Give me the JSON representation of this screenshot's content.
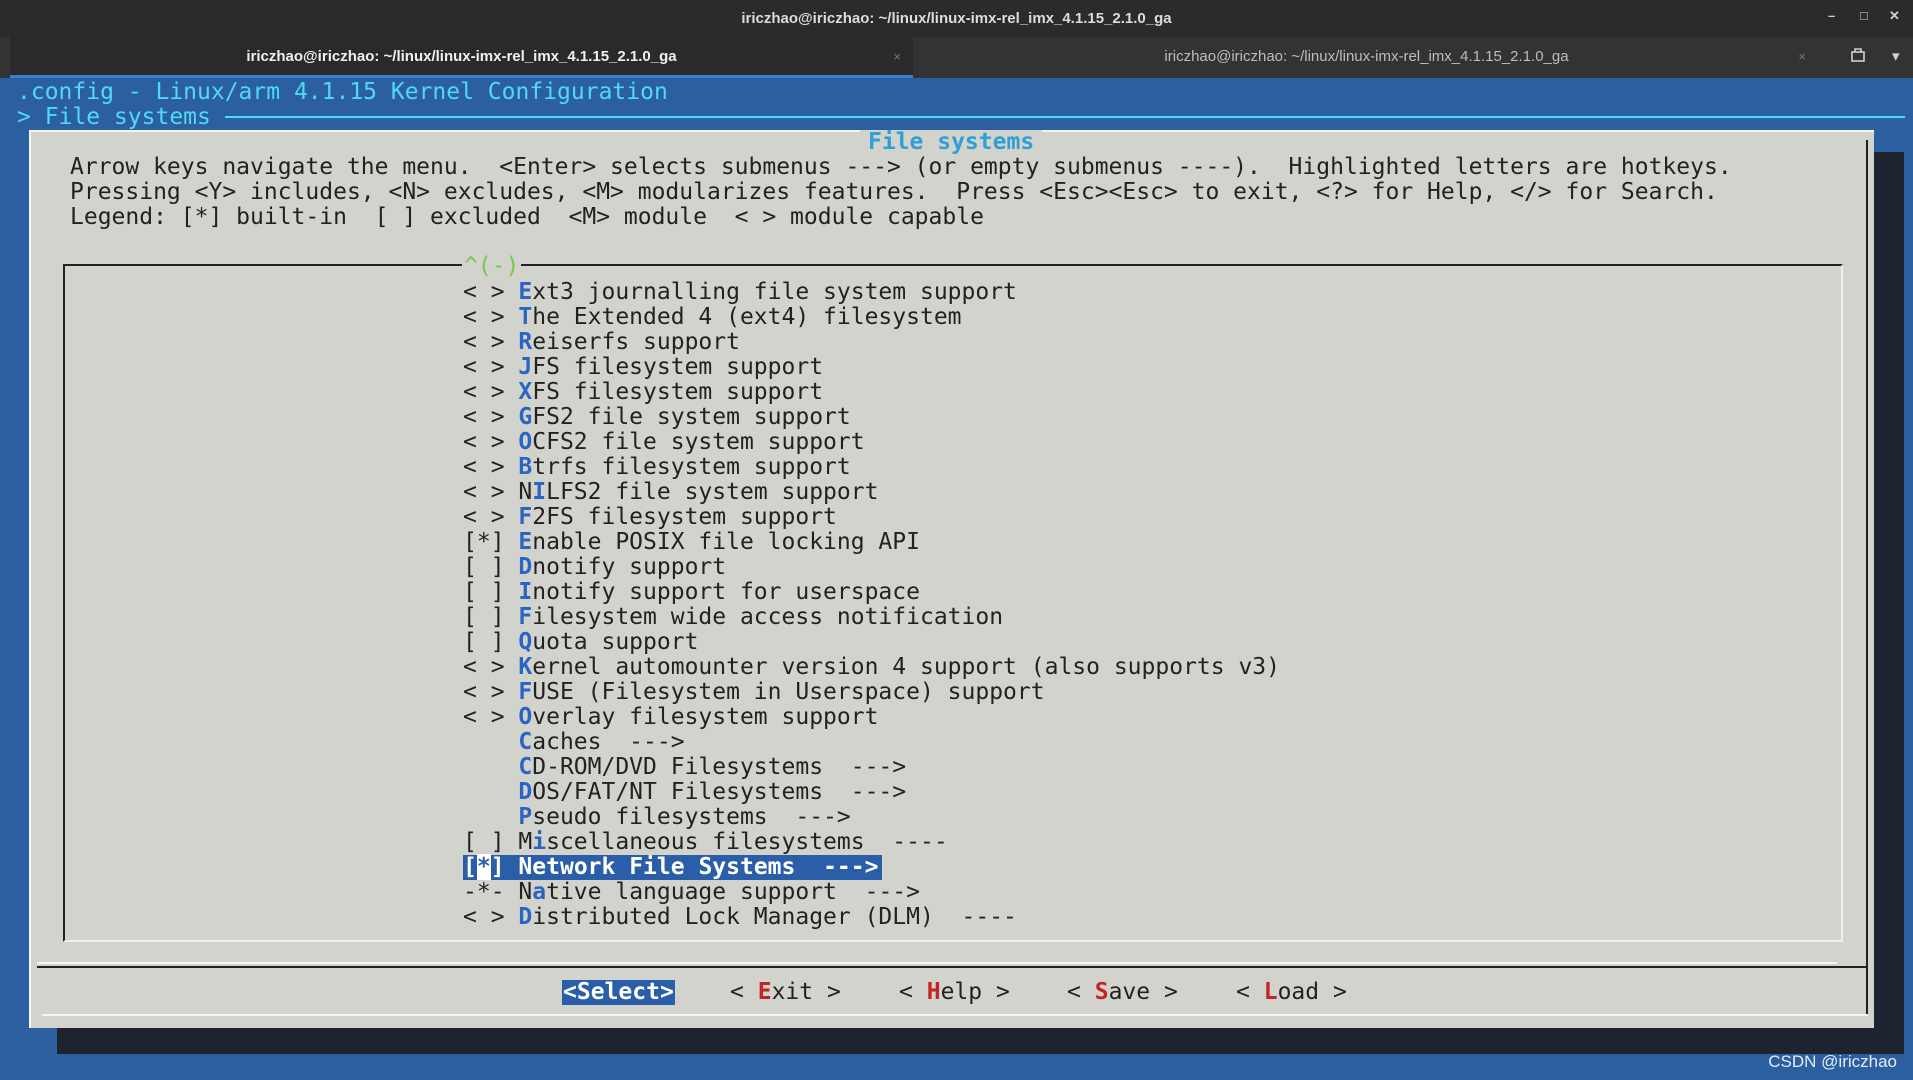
{
  "window": {
    "title": "iriczhao@iriczhao: ~/linux/linux-imx-rel_imx_4.1.15_2.1.0_ga",
    "controls": {
      "minimize": "–",
      "maximize": "□",
      "close": "✕"
    }
  },
  "tabs": [
    {
      "label": "iriczhao@iriczhao: ~/linux/linux-imx-rel_imx_4.1.15_2.1.0_ga",
      "active": true,
      "close": "×"
    },
    {
      "label": "iriczhao@iriczhao: ~/linux/linux-imx-rel_imx_4.1.15_2.1.0_ga",
      "active": false,
      "close": "×"
    }
  ],
  "tabbar_icons": {
    "new_tab": "new-tab-icon",
    "menu": "▾"
  },
  "terminal": {
    "config_header": ".config - Linux/arm 4.1.15 Kernel Configuration",
    "breadcrumb": "> File systems"
  },
  "dialog": {
    "title": "File systems",
    "help_lines": [
      "Arrow keys navigate the menu.  <Enter> selects submenus ---> (or empty submenus ----).  Highlighted letters are hotkeys.",
      "Pressing <Y> includes, <N> excludes, <M> modularizes features.  Press <Esc><Esc> to exit, <?> for Help, </> for Search.",
      "Legend: [*] built-in  [ ] excluded  <M> module  < > module capable"
    ],
    "scroll_indicator": "^(-)"
  },
  "menu_items": [
    {
      "prefix": "< > ",
      "pre": "",
      "hk": "E",
      "post": "xt3 journalling file system support"
    },
    {
      "prefix": "< > ",
      "pre": "",
      "hk": "T",
      "post": "he Extended 4 (ext4) filesystem"
    },
    {
      "prefix": "< > ",
      "pre": "",
      "hk": "R",
      "post": "eiserfs support"
    },
    {
      "prefix": "< > ",
      "pre": "",
      "hk": "J",
      "post": "FS filesystem support"
    },
    {
      "prefix": "< > ",
      "pre": "",
      "hk": "X",
      "post": "FS filesystem support"
    },
    {
      "prefix": "< > ",
      "pre": "",
      "hk": "G",
      "post": "FS2 file system support"
    },
    {
      "prefix": "< > ",
      "pre": "",
      "hk": "O",
      "post": "CFS2 file system support"
    },
    {
      "prefix": "< > ",
      "pre": "",
      "hk": "B",
      "post": "trfs filesystem support"
    },
    {
      "prefix": "< > ",
      "pre": "N",
      "hk": "I",
      "post": "LFS2 file system support"
    },
    {
      "prefix": "< > ",
      "pre": "",
      "hk": "F",
      "post": "2FS filesystem support"
    },
    {
      "prefix": "[*] ",
      "pre": "",
      "hk": "E",
      "post": "nable POSIX file locking API"
    },
    {
      "prefix": "[ ] ",
      "pre": "",
      "hk": "D",
      "post": "notify support"
    },
    {
      "prefix": "[ ] ",
      "pre": "",
      "hk": "I",
      "post": "notify support for userspace"
    },
    {
      "prefix": "[ ] ",
      "pre": "",
      "hk": "F",
      "post": "ilesystem wide access notification"
    },
    {
      "prefix": "[ ] ",
      "pre": "",
      "hk": "Q",
      "post": "uota support"
    },
    {
      "prefix": "< > ",
      "pre": "",
      "hk": "K",
      "post": "ernel automounter version 4 support (also supports v3)"
    },
    {
      "prefix": "< > ",
      "pre": "",
      "hk": "F",
      "post": "USE (Filesystem in Userspace) support"
    },
    {
      "prefix": "< > ",
      "pre": "",
      "hk": "O",
      "post": "verlay filesystem support"
    },
    {
      "prefix": "    ",
      "pre": "",
      "hk": "C",
      "post": "aches  --->"
    },
    {
      "prefix": "    ",
      "pre": "",
      "hk": "C",
      "post": "D-ROM/DVD Filesystems  --->"
    },
    {
      "prefix": "    ",
      "pre": "",
      "hk": "D",
      "post": "OS/FAT/NT Filesystems  --->"
    },
    {
      "prefix": "    ",
      "pre": "",
      "hk": "P",
      "post": "seudo filesystems  --->"
    },
    {
      "prefix": "[ ] ",
      "pre": "M",
      "hk": "i",
      "post": "scellaneous filesystems  ----"
    },
    {
      "prefix": "[*] ",
      "pre": "",
      "hk": "N",
      "post": "etwork File Systems  --->",
      "selected": true
    },
    {
      "prefix": "-*- ",
      "pre": "N",
      "hk": "a",
      "post": "tive language support  --->"
    },
    {
      "prefix": "< > ",
      "pre": "",
      "hk": "D",
      "post": "istributed Lock Manager (DLM)  ----"
    }
  ],
  "buttons": [
    {
      "name": "select-button",
      "open": "<",
      "hk": "S",
      "rest": "elect",
      "close": ">",
      "selected": true
    },
    {
      "name": "exit-button",
      "open": "< ",
      "hk": "E",
      "rest": "xit",
      "close": " >"
    },
    {
      "name": "help-button",
      "open": "< ",
      "hk": "H",
      "rest": "elp",
      "close": " >"
    },
    {
      "name": "save-button",
      "open": "< ",
      "hk": "S",
      "rest": "ave",
      "close": " >"
    },
    {
      "name": "load-button",
      "open": "< ",
      "hk": "L",
      "rest": "oad",
      "close": " >"
    }
  ],
  "watermark": "CSDN @iriczhao",
  "colors": {
    "terminal_bg": "#2b5f9f",
    "dialog_bg": "#d3d3cd",
    "header_text": "#52d9f2",
    "hotkey": "#2a65c4",
    "selection_bg": "#2a5ea8",
    "button_hotkey": "#c32525",
    "scroll_indicator": "#78c84a"
  }
}
